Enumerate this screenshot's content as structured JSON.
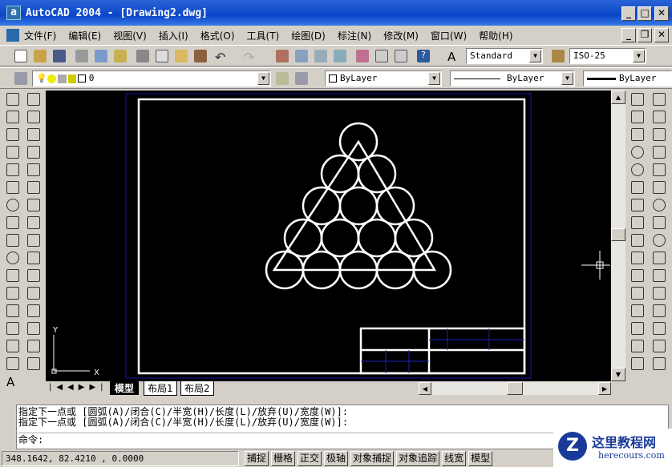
{
  "window": {
    "title": "AutoCAD 2004 - [Drawing2.dwg]",
    "app_icon": "a"
  },
  "menu": [
    "文件(F)",
    "编辑(E)",
    "视图(V)",
    "插入(I)",
    "格式(O)",
    "工具(T)",
    "绘图(D)",
    "标注(N)",
    "修改(M)",
    "窗口(W)",
    "帮助(H)"
  ],
  "toolbar": {
    "text_style": "Standard",
    "dim_style": "ISO-25"
  },
  "properties": {
    "layer": "0",
    "color": "ByLayer",
    "linetype": "ByLayer",
    "lineweight": "ByLayer"
  },
  "ucs": {
    "x": "X",
    "y": "Y"
  },
  "tabs": [
    "模型",
    "布局1",
    "布局2"
  ],
  "command": {
    "history": [
      "指定下一点或 [圆弧(A)/闭合(C)/半宽(H)/长度(L)/放弃(U)/宽度(W)]:",
      "指定下一点或 [圆弧(A)/闭合(C)/半宽(H)/长度(L)/放弃(U)/宽度(W)]:"
    ],
    "prompt": "命令:"
  },
  "status": {
    "coords": "348.1642, 82.4210 , 0.0000",
    "buttons": [
      "捕捉",
      "栅格",
      "正交",
      "极轴",
      "对象捕捉",
      "对象追踪",
      "线宽",
      "模型"
    ]
  },
  "logo": {
    "name": "这里教程网",
    "url": "herecours.com"
  },
  "colors": {
    "titlebar": "#0a46c8",
    "canvas": "#000000",
    "lines": "#ffffff",
    "paper_border": "#1a1aa0"
  }
}
